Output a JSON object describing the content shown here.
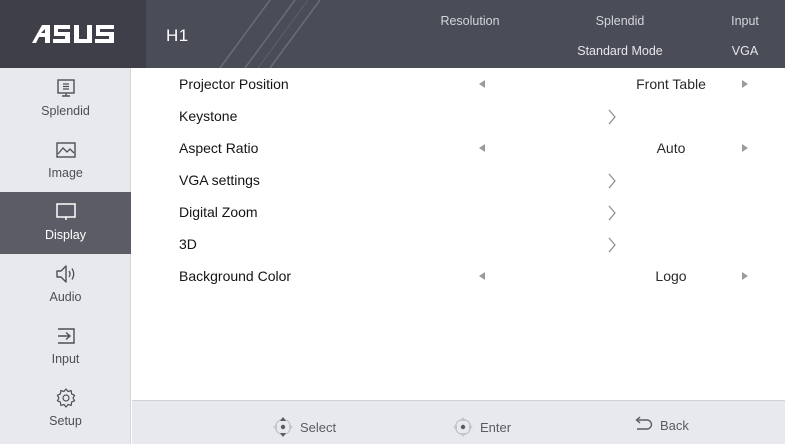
{
  "header": {
    "brand": "ASUS",
    "model": "H1",
    "status": [
      {
        "label": "Resolution",
        "value": ""
      },
      {
        "label": "Splendid",
        "value": "Standard Mode"
      },
      {
        "label": "Input",
        "value": "VGA"
      }
    ]
  },
  "sidebar": {
    "active": "Display",
    "items": [
      {
        "label": "Splendid",
        "icon": "splendid-icon"
      },
      {
        "label": "Image",
        "icon": "image-icon"
      },
      {
        "label": "Display",
        "icon": "display-icon"
      },
      {
        "label": "Audio",
        "icon": "speaker-icon"
      },
      {
        "label": "Input",
        "icon": "input-icon"
      },
      {
        "label": "Setup",
        "icon": "gear-icon"
      }
    ]
  },
  "menu": {
    "items": [
      {
        "label": "Projector Position",
        "type": "select",
        "value": "Front Table"
      },
      {
        "label": "Keystone",
        "type": "submenu",
        "value": ""
      },
      {
        "label": "Aspect Ratio",
        "type": "select",
        "value": "Auto"
      },
      {
        "label": "VGA settings",
        "type": "submenu",
        "value": ""
      },
      {
        "label": "Digital Zoom",
        "type": "submenu",
        "value": ""
      },
      {
        "label": "3D",
        "type": "submenu",
        "value": ""
      },
      {
        "label": "Background Color",
        "type": "select",
        "value": "Logo"
      }
    ]
  },
  "footer": {
    "select": "Select",
    "enter": "Enter",
    "back": "Back"
  },
  "colors": {
    "header_bg": "#4a4c57",
    "sidebar_bg": "#e8e9ec",
    "active_bg": "#5b5c66"
  }
}
